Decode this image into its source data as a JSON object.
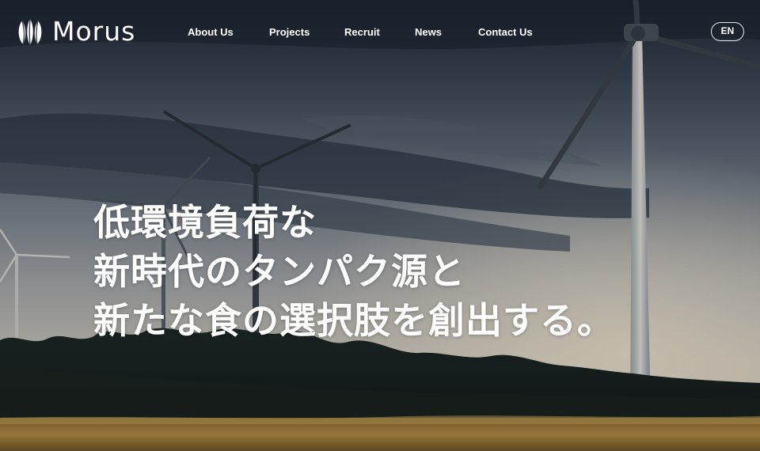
{
  "brand": {
    "name": "Morus",
    "logo_icon": "morus-leaf-logo-icon"
  },
  "nav": {
    "items": [
      {
        "label": "About Us"
      },
      {
        "label": "Projects"
      },
      {
        "label": "Recruit"
      },
      {
        "label": "News"
      },
      {
        "label": "Contact Us"
      }
    ],
    "language_button": "EN"
  },
  "hero": {
    "headline_lines": [
      "低環境負荷な",
      "新時代のタンパク源と",
      "新たな食の選択肢を創出する。"
    ],
    "background": "wind-turbines-at-dusk-photo"
  },
  "colors": {
    "text": "#ffffff",
    "sky_top": "#1f2a36",
    "sky_horizon": "#d9d2c4",
    "field": "#b08a3e"
  }
}
